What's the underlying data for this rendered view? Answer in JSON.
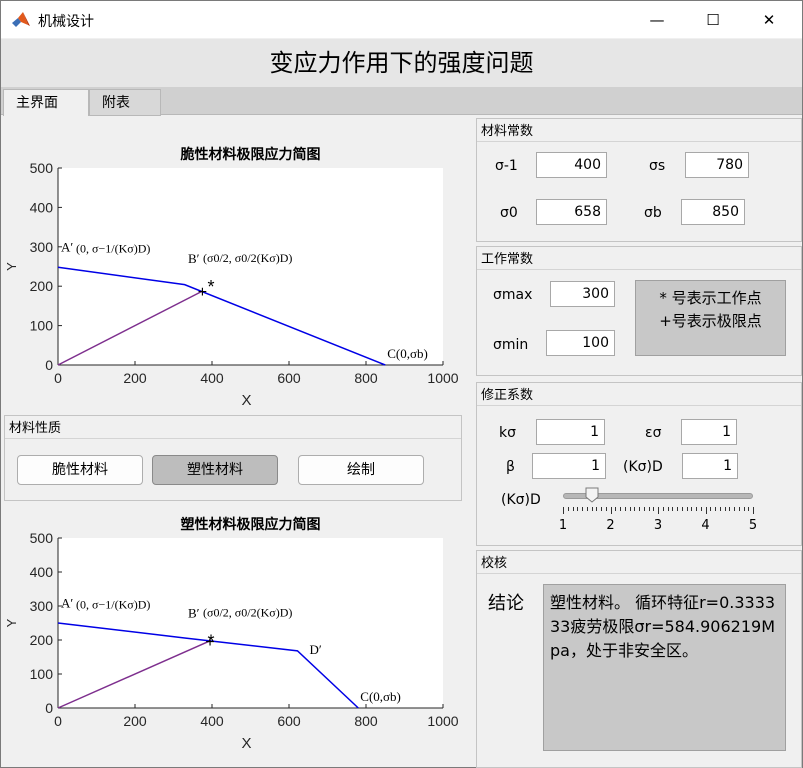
{
  "window": {
    "title": "机械设计",
    "minimize_glyph": "—",
    "maximize_glyph": "☐",
    "close_glyph": "✕"
  },
  "figure_title": "变应力作用下的强度问题",
  "tabs": [
    {
      "label": "主界面"
    },
    {
      "label": "附表"
    }
  ],
  "charts": [
    {
      "title": "脆性材料极限应力简图",
      "xlabel": "X",
      "ylabel": "Y",
      "xlim": [
        0,
        1000
      ],
      "ylim": [
        0,
        500
      ],
      "xticks": [
        0,
        200,
        400,
        600,
        800,
        1000
      ],
      "yticks": [
        0,
        100,
        200,
        300,
        400,
        500
      ],
      "limit_line": [
        [
          0,
          248
        ],
        [
          329,
          204
        ],
        [
          850,
          0
        ]
      ],
      "work_line": [
        [
          0,
          0
        ],
        [
          375,
          187.5
        ]
      ],
      "work_point": [
        375,
        187.5
      ],
      "limit_point": [
        400,
        203
      ],
      "annotations": {
        "A": "A′",
        "A_expr": "(0, σ−1/(Kσ)D)",
        "B": "B′",
        "B_expr": "(σ0/2, σ0/2(Kσ)D)",
        "C": "C(0,σb)"
      }
    },
    {
      "title": "塑性材料极限应力简图",
      "xlabel": "X",
      "ylabel": "Y",
      "xlim": [
        0,
        1000
      ],
      "ylim": [
        0,
        500
      ],
      "xticks": [
        0,
        200,
        400,
        600,
        800,
        1000
      ],
      "yticks": [
        0,
        100,
        200,
        300,
        400,
        500
      ],
      "limit_line": [
        [
          0,
          250
        ],
        [
          329,
          206
        ],
        [
          622,
          168
        ],
        [
          780,
          0
        ]
      ],
      "work_line": [
        [
          0,
          0
        ],
        [
          395,
          197.5
        ]
      ],
      "work_point": [
        395,
        197.5
      ],
      "limit_point": [
        400,
        201
      ],
      "annotations": {
        "A": "A′",
        "A_expr": "(0, σ−1/(Kσ)D)",
        "B": "B′",
        "B_expr": "(σ0/2, σ0/2(Kσ)D)",
        "C": "C(0,σb)",
        "D": "D′"
      }
    }
  ],
  "material_type": {
    "title": "材料性质",
    "buttons": [
      {
        "label": "脆性材料",
        "pressed": false
      },
      {
        "label": "塑性材料",
        "pressed": true
      },
      {
        "label": "绘制",
        "pressed": false
      }
    ]
  },
  "material_constants": {
    "title": "材料常数",
    "fields": [
      {
        "label": "σ-1",
        "value": "400"
      },
      {
        "label": "σs",
        "value": "780"
      },
      {
        "label": "σ0",
        "value": "658"
      },
      {
        "label": "σb",
        "value": "850"
      }
    ]
  },
  "work_constants": {
    "title": "工作常数",
    "fields": [
      {
        "label": "σmax",
        "value": "300"
      },
      {
        "label": "σmin",
        "value": "100"
      }
    ],
    "legend_line1": "* 号表示工作点",
    "legend_line2": "+号表示极限点"
  },
  "correction": {
    "title": "修正系数",
    "fields": [
      {
        "label": "kσ",
        "value": "1"
      },
      {
        "label": "εσ",
        "value": "1"
      },
      {
        "label": "β",
        "value": "1"
      },
      {
        "label": "(Kσ)D",
        "value": "1"
      }
    ],
    "slider_label": "(Kσ)D",
    "slider_min": 1,
    "slider_max": 5,
    "slider_value": 1.6,
    "slider_ticks": [
      "1",
      "2",
      "3",
      "4",
      "5"
    ]
  },
  "check": {
    "title": "校核",
    "conclusion_label": "结论",
    "result_text": "塑性材料。 循环特征r=0.333333疲劳极限σr=584.906219Mpa，处于非安全区。"
  },
  "colors": {
    "limit_line": "#0000e6",
    "work_line": "#7e2f8e"
  }
}
